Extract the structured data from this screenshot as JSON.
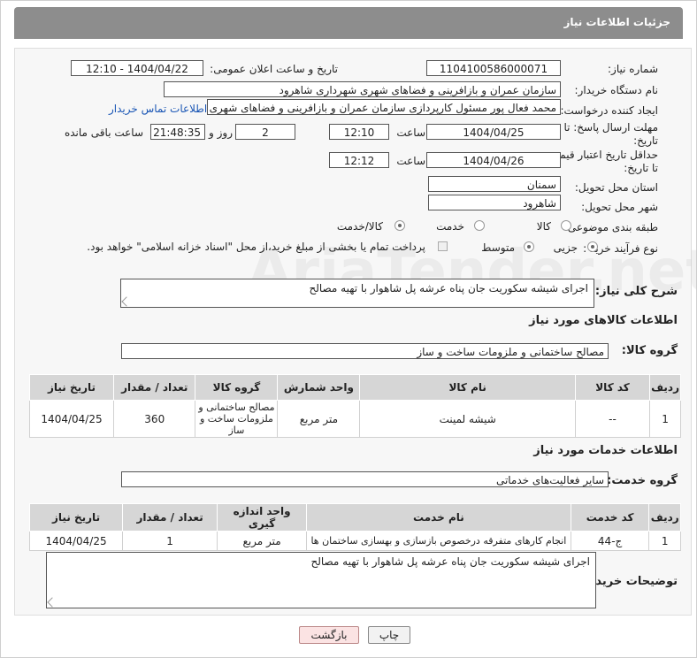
{
  "page": {
    "title": "جزئیات اطلاعات نیاز"
  },
  "fields": {
    "need_number_label": "شماره نیاز:",
    "need_number": "1104100586000071",
    "announce_label": "تاریخ و ساعت اعلان عمومی:",
    "announce_value": "1404/04/22 - 12:10",
    "buyer_org_label": "نام دستگاه خریدار:",
    "buyer_org": "سازمان عمران و بازافرینی و فضاهای شهری شهرداری شاهرود",
    "requester_label": "ایجاد کننده درخواست:",
    "requester": "محمد فعال پور مسئول کارپردازی سازمان عمران و بازافرینی و فضاهای شهری ش",
    "contact_link": "اطلاعات تماس خریدار",
    "reply_deadline_label_1": "مهلت ارسال پاسخ: تا",
    "reply_deadline_label_2": "تاریخ:",
    "reply_date": "1404/04/25",
    "time_label": "ساعت",
    "reply_time": "12:10",
    "days_value": "2",
    "days_label": "روز و",
    "remaining_time": "21:48:35",
    "remaining_label": "ساعت باقی مانده",
    "validity_label_1": "حداقل تاریخ اعتبار قیمت:",
    "validity_label_2": "تا تاریخ:",
    "validity_date": "1404/04/26",
    "validity_time": "12:12",
    "province_label": "استان محل تحویل:",
    "province": "سمنان",
    "city_label": "شهر محل تحویل:",
    "city": "شاهرود",
    "category_label": "طبقه بندی موضوعی:",
    "category_options": [
      "کالا",
      "خدمت",
      "کالا/خدمت"
    ],
    "process_label": "نوع فرآیند خرید :",
    "process_options": [
      "جزیی",
      "متوسط"
    ],
    "payment_note": "پرداخت تمام یا بخشی از مبلغ خرید،از محل \"اسناد خزانه اسلامی\" خواهد بود."
  },
  "summary": {
    "label": "شرح کلی نیاز:",
    "text": "اجرای شیشه سکوریت جان پناه عرشه پل شاهوار با تهیه مصالح"
  },
  "goods": {
    "section_title": "اطلاعات کالاهای مورد نیاز",
    "group_label": "گروه کالا:",
    "group_value": "مصالح ساختمانی و ملزومات ساخت و ساز",
    "headers": [
      "ردیف",
      "کد کالا",
      "نام کالا",
      "واحد شمارش",
      "گروه کالا",
      "تعداد / مقدار",
      "تاریخ نیاز"
    ],
    "rows": [
      {
        "row": "1",
        "code": "--",
        "name": "شیشه لمینت",
        "unit": "متر مربع",
        "group": "مصالح ساختمانی و ملزومات ساخت و ساز",
        "qty": "360",
        "date": "1404/04/25"
      }
    ]
  },
  "services": {
    "section_title": "اطلاعات خدمات مورد نیاز",
    "group_label": "گروه خدمت:",
    "group_value": "سایر فعالیت‌های خدماتی",
    "headers": [
      "ردیف",
      "کد خدمت",
      "نام خدمت",
      "واحد اندازه گیری",
      "تعداد / مقدار",
      "تاریخ نیاز"
    ],
    "rows": [
      {
        "row": "1",
        "code": "ج-44",
        "name": "انجام کارهای متفرقه درخصوص بازسازی و بهسازی ساختمان ها",
        "unit": "متر مربع",
        "qty": "1",
        "date": "1404/04/25"
      }
    ]
  },
  "buyer_notes": {
    "label": "توضیحات خریدار:",
    "text": "اجرای شیشه سکوریت جان پناه عرشه پل شاهوار با تهیه مصالح"
  },
  "buttons": {
    "print": "چاپ",
    "back": "بازگشت"
  },
  "watermark": "AriaTender.net"
}
